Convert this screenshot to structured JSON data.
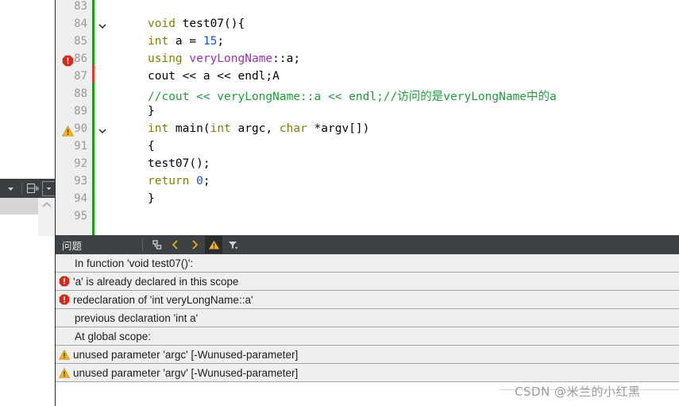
{
  "editor": {
    "first_line": 83,
    "lines": [
      {
        "num": "83",
        "fold": "",
        "marker": "",
        "tokens": []
      },
      {
        "num": "84",
        "fold": "⌄",
        "marker": "",
        "tokens": [
          {
            "t": "void",
            "c": "kw"
          },
          {
            "t": " ",
            "c": "plain"
          },
          {
            "t": "test07(){",
            "c": "plain"
          }
        ]
      },
      {
        "num": "85",
        "fold": "",
        "marker": "",
        "tokens": [
          {
            "t": "    ",
            "c": "plain"
          },
          {
            "t": "int",
            "c": "kw"
          },
          {
            "t": " a = ",
            "c": "plain"
          },
          {
            "t": "15",
            "c": "num"
          },
          {
            "t": ";",
            "c": "plain"
          }
        ]
      },
      {
        "num": "86",
        "fold": "",
        "marker": "error",
        "tokens": [
          {
            "t": "    ",
            "c": "plain"
          },
          {
            "t": "using",
            "c": "kw"
          },
          {
            "t": "  ",
            "c": "plain"
          },
          {
            "t": "veryLongName",
            "c": "ns"
          },
          {
            "t": "::a;",
            "c": "plain"
          }
        ]
      },
      {
        "num": "87",
        "fold": "",
        "marker": "",
        "tokens": [
          {
            "t": "    cout << a << endl;A",
            "c": "plain"
          }
        ]
      },
      {
        "num": "88",
        "fold": "",
        "marker": "",
        "tokens": [
          {
            "t": "    //cout << veryLongName::a << endl;//访问的是veryLongName中的a",
            "c": "cmt"
          }
        ]
      },
      {
        "num": "89",
        "fold": "",
        "marker": "",
        "tokens": [
          {
            "t": "}",
            "c": "plain"
          }
        ]
      },
      {
        "num": "90",
        "fold": "⌄",
        "marker": "warning",
        "tokens": [
          {
            "t": "int",
            "c": "kw"
          },
          {
            "t": " main(",
            "c": "plain"
          },
          {
            "t": "int",
            "c": "kw"
          },
          {
            "t": " argc, ",
            "c": "plain"
          },
          {
            "t": "char",
            "c": "kw"
          },
          {
            "t": " *argv[])",
            "c": "plain"
          }
        ]
      },
      {
        "num": "91",
        "fold": "",
        "marker": "",
        "tokens": [
          {
            "t": "{",
            "c": "plain"
          }
        ]
      },
      {
        "num": "92",
        "fold": "",
        "marker": "",
        "tokens": [
          {
            "t": "    test07();",
            "c": "plain"
          }
        ]
      },
      {
        "num": "93",
        "fold": "",
        "marker": "",
        "tokens": [
          {
            "t": "    ",
            "c": "plain"
          },
          {
            "t": "return",
            "c": "kw"
          },
          {
            "t": " ",
            "c": "plain"
          },
          {
            "t": "0",
            "c": "num"
          },
          {
            "t": ";",
            "c": "plain"
          }
        ]
      },
      {
        "num": "94",
        "fold": "",
        "marker": "",
        "tokens": [
          {
            "t": "}",
            "c": "plain"
          }
        ]
      },
      {
        "num": "95",
        "fold": "",
        "marker": "",
        "tokens": []
      }
    ],
    "vcs_strip_color": "#1a9e1a",
    "vcs_modified_color": "#e8372b"
  },
  "left_rail": {
    "toolbar": {
      "dropdown_label": "▾",
      "split_label": "▤+",
      "close_label": "▭"
    }
  },
  "problems_panel": {
    "title": "问题",
    "tools": [
      {
        "name": "clear-all-icon",
        "glyph": "⌫",
        "active": false,
        "gray": true
      },
      {
        "name": "previous-problem-icon",
        "glyph": "‹",
        "active": false,
        "gray": false
      },
      {
        "name": "next-problem-icon",
        "glyph": "›",
        "active": false,
        "gray": false
      },
      {
        "name": "warnings-filter-icon",
        "glyph": "⚠",
        "active": true,
        "gray": false
      },
      {
        "name": "filter-icon",
        "glyph": "▽",
        "active": false,
        "gray": true
      }
    ],
    "rows": [
      {
        "severity": "none",
        "text": "In function 'void test07()':"
      },
      {
        "severity": "error",
        "text": "'a' is already declared in this scope"
      },
      {
        "severity": "error",
        "text": "redeclaration of 'int veryLongName::a'"
      },
      {
        "severity": "none",
        "text": "previous declaration 'int a'"
      },
      {
        "severity": "none",
        "text": "At global scope:"
      },
      {
        "severity": "warning",
        "text": "unused parameter 'argc' [-Wunused-parameter]"
      },
      {
        "severity": "warning",
        "text": "unused parameter 'argv' [-Wunused-parameter]"
      }
    ]
  },
  "watermark": {
    "text": "CSDN @米兰的小红黑"
  },
  "colors": {
    "error": "#d42b1f",
    "warning": "#f0b323",
    "keyword": "#808000",
    "number": "#1750eb",
    "namespace": "#9b30b0",
    "comment": "#1f9e38",
    "panel_header_bg": "#3f4244",
    "gutter_bg": "#efefef",
    "row_bg": "#efefef"
  }
}
